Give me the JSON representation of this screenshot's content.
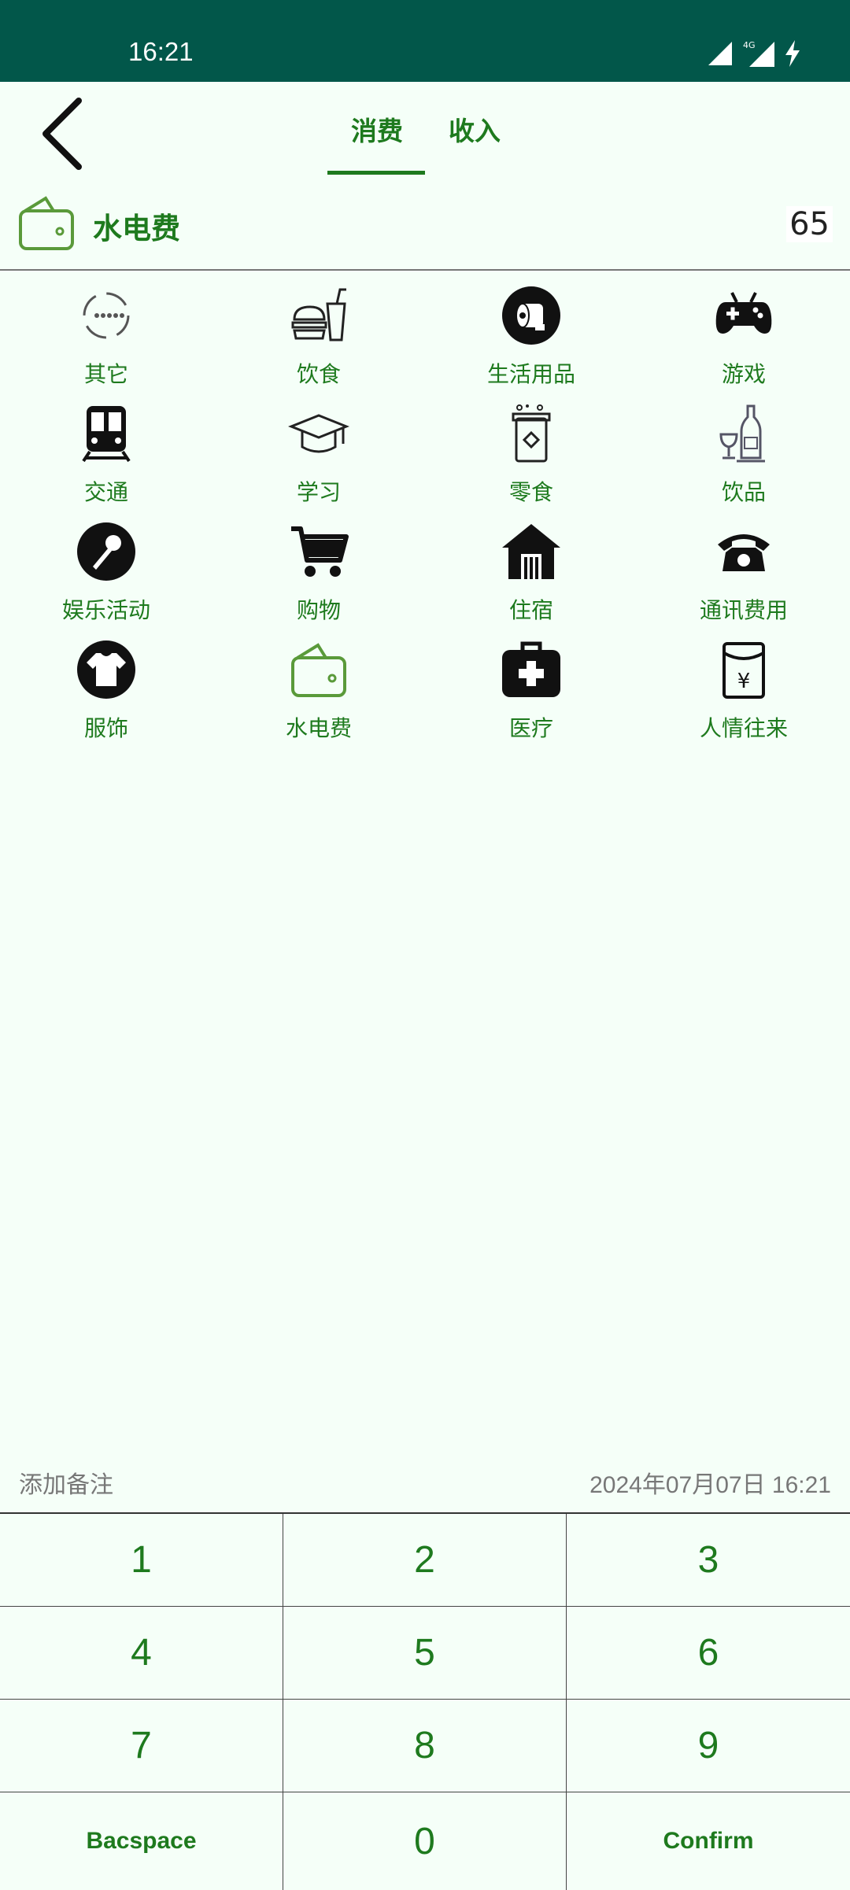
{
  "status": {
    "time": "16:21",
    "network": "4G"
  },
  "tabs": [
    {
      "label": "消费",
      "active": true
    },
    {
      "label": "收入",
      "active": false
    }
  ],
  "selected": {
    "category": "水电费",
    "amount": "65"
  },
  "categories": [
    {
      "label": "其它",
      "icon": "dots-circle-icon"
    },
    {
      "label": "饮食",
      "icon": "fast-food-icon"
    },
    {
      "label": "生活用品",
      "icon": "toilet-paper-icon"
    },
    {
      "label": "游戏",
      "icon": "gamepad-icon"
    },
    {
      "label": "交通",
      "icon": "train-icon"
    },
    {
      "label": "学习",
      "icon": "graduation-cap-icon"
    },
    {
      "label": "零食",
      "icon": "snack-jar-icon"
    },
    {
      "label": "饮品",
      "icon": "drinks-icon"
    },
    {
      "label": "娱乐活动",
      "icon": "microphone-icon"
    },
    {
      "label": "购物",
      "icon": "shopping-cart-icon"
    },
    {
      "label": "住宿",
      "icon": "house-icon"
    },
    {
      "label": "通讯费用",
      "icon": "telephone-icon"
    },
    {
      "label": "服饰",
      "icon": "tshirt-icon"
    },
    {
      "label": "水电费",
      "icon": "wallet-icon"
    },
    {
      "label": "医疗",
      "icon": "medical-kit-icon"
    },
    {
      "label": "人情往来",
      "icon": "red-envelope-icon"
    }
  ],
  "note": {
    "placeholder": "添加备注",
    "datetime": "2024年07月07日 16:21"
  },
  "keypad": [
    [
      "1",
      "2",
      "3"
    ],
    [
      "4",
      "5",
      "6"
    ],
    [
      "7",
      "8",
      "9"
    ],
    [
      "Bacspace",
      "0",
      "Confirm"
    ]
  ],
  "colors": {
    "statusbar": "#02574A",
    "accent": "#1E7A1E",
    "background": "#F5FFF8",
    "wallet": "#5A9A3A"
  }
}
